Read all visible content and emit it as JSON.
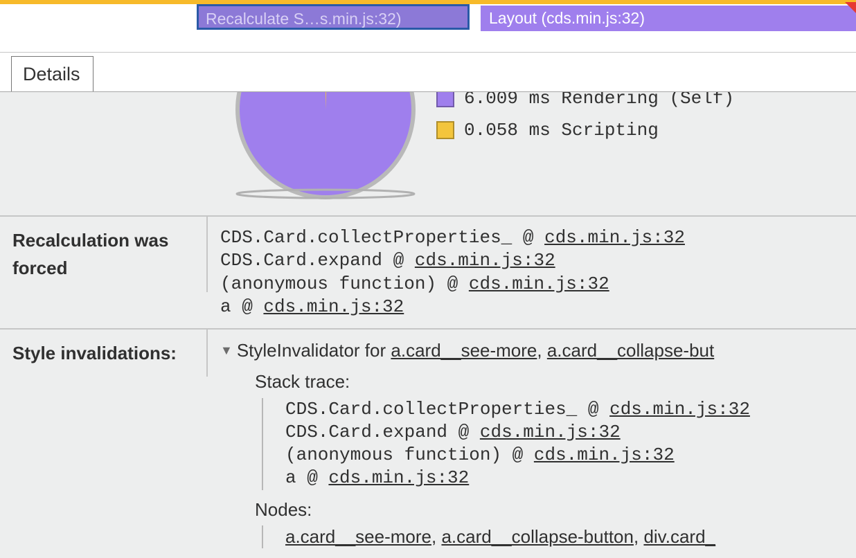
{
  "flame": {
    "recalc_label": "Recalculate S…s.min.js:32)",
    "layout_label": "Layout (cds.min.js:32)"
  },
  "tabs": {
    "details": "Details"
  },
  "legend": {
    "rendering": "6.009 ms Rendering (Self)",
    "scripting": "0.058 ms Scripting"
  },
  "recalc": {
    "label": "Recalculation was forced",
    "stack": {
      "l0_fn": "CDS.Card.collectProperties_",
      "l0_at": " @ ",
      "l0_src": "cds.min.js:32",
      "l1_fn": "CDS.Card.expand",
      "l1_at": " @ ",
      "l1_src": "cds.min.js:32",
      "l2_fn": "(anonymous function)",
      "l2_at": " @ ",
      "l2_src": "cds.min.js:32",
      "l3_fn": "a",
      "l3_at": " @ ",
      "l3_src": "cds.min.js:32"
    }
  },
  "inval": {
    "label": "Style invalidations:",
    "header_prefix": "StyleInvalidator for ",
    "header_link1": "a.card__see-more",
    "header_sep1": ", ",
    "header_link2": "a.card__collapse-but",
    "stacktrace_title": "Stack trace:",
    "stack": {
      "l0_fn": "CDS.Card.collectProperties_",
      "l0_at": " @ ",
      "l0_src": "cds.min.js:32",
      "l1_fn": "CDS.Card.expand",
      "l1_at": " @ ",
      "l1_src": "cds.min.js:32",
      "l2_fn": "(anonymous function)",
      "l2_at": " @ ",
      "l2_src": "cds.min.js:32",
      "l3_fn": "a",
      "l3_at": " @ ",
      "l3_src": "cds.min.js:32"
    },
    "nodes_title": "Nodes:",
    "nodes": {
      "n0": "a.card__see-more",
      "s0": ", ",
      "n1": "a.card__collapse-button",
      "s1": ", ",
      "n2": "div.card_"
    }
  },
  "chart_data": {
    "type": "pie",
    "title": "",
    "series": [
      {
        "name": "Rendering (Self)",
        "value": 6.009,
        "color": "#9f7fed"
      },
      {
        "name": "Scripting",
        "value": 0.058,
        "color": "#f3c53c"
      }
    ],
    "unit": "ms"
  }
}
